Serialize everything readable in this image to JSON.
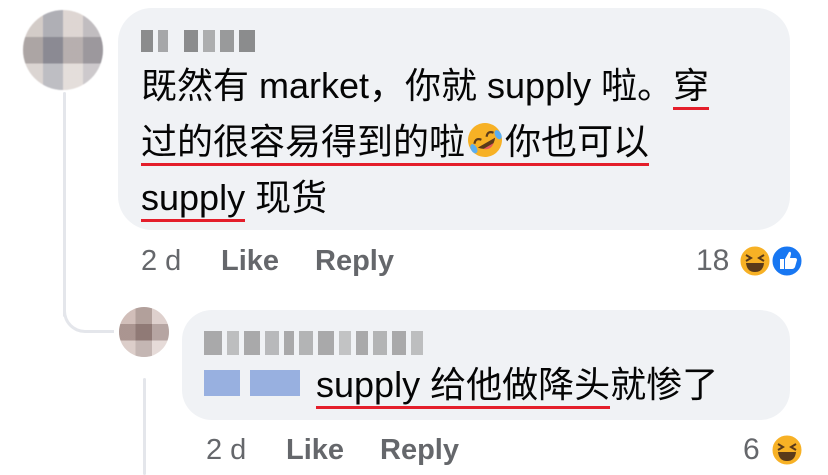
{
  "comment": {
    "author_blurred": true,
    "lines": [
      {
        "plain": "既然有 market，你就 supply 啦。",
        "underlined": "穿"
      },
      {
        "underlined_a": "过的很容易得到的啦",
        "emoji": "rolling-on-floor-laughing",
        "underlined_b": "你也可以"
      },
      {
        "underlined": "supply",
        "plain": " 现货"
      }
    ],
    "time": "2 d",
    "like_label": "Like",
    "reply_label": "Reply",
    "reaction_count": "18",
    "reactions": [
      "haha",
      "like"
    ]
  },
  "reply": {
    "author_blurred": true,
    "mention_blurred": true,
    "text_underlined": "supply 给他做降头",
    "text_plain": "就惨了",
    "time": "2 d",
    "like_label": "Like",
    "reply_label": "Reply",
    "reaction_count": "6",
    "reactions": [
      "haha"
    ]
  },
  "colors": {
    "bubble": "#f0f2f5",
    "meta_text": "#65676b",
    "underline": "#e41e2b",
    "like_blue": "#1877f2",
    "haha_yellow": "#f7b125"
  }
}
